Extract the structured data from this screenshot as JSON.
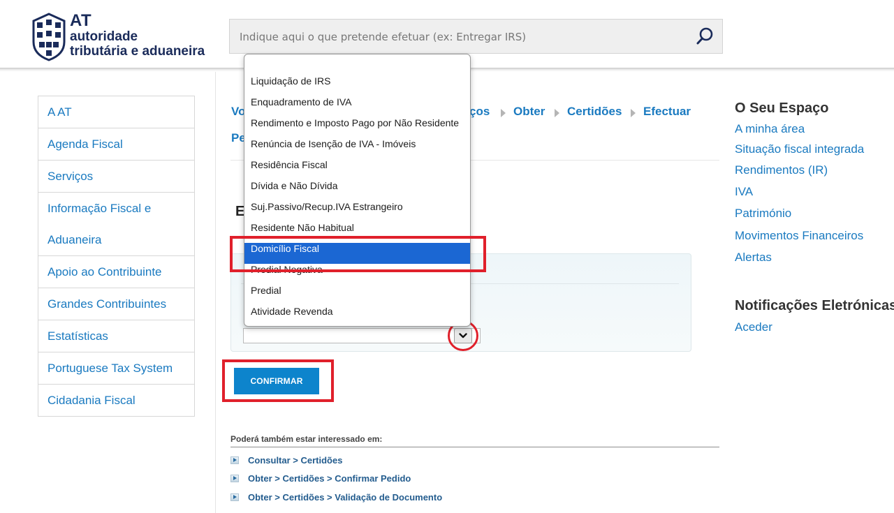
{
  "header": {
    "logo_at": "AT",
    "logo_line1": "autoridade",
    "logo_line2": "tributária e aduaneira",
    "search_placeholder": "Indique aqui o que pretende efetuar (ex: Entregar IRS)"
  },
  "leftnav": {
    "items": [
      {
        "label": "A AT"
      },
      {
        "label": "Agenda Fiscal"
      },
      {
        "label": "Serviços"
      },
      {
        "label_line1": "Informação Fiscal e",
        "label_line2": "Aduaneira"
      },
      {
        "label": "Apoio ao Contribuinte"
      },
      {
        "label": "Grandes Contribuintes"
      },
      {
        "label": "Estatísticas"
      },
      {
        "label": "Portuguese Tax System"
      },
      {
        "label": "Cidadania Fiscal"
      }
    ]
  },
  "breadcrumb": {
    "partial_left_1": "Vo",
    "partial_right": "ços",
    "obter": "Obter",
    "certidoes": "Certidões",
    "efectuar": "Efectuar",
    "partial_left_2": "Pe"
  },
  "section": {
    "title_partial": "E"
  },
  "dropdown": {
    "options": [
      "Liquidação de IRS",
      "Enquadramento de IVA",
      "Rendimento e Imposto Pago por Não Residente",
      "Renúncia de Isenção de IVA - Imóveis",
      "Residência Fiscal",
      "Dívida e Não Dívida",
      "Suj.Passivo/Recup.IVA Estrangeiro",
      "Residente Não Habitual",
      "Domicílio Fiscal",
      "Predial Negativa",
      "Predial",
      "Atividade Revenda"
    ],
    "selected": "Domicílio Fiscal"
  },
  "confirm_label": "CONFIRMAR",
  "related": {
    "title": "Poderá também estar interessado em:",
    "links": [
      "Consultar > Certidões",
      "Obter > Certidões > Confirmar Pedido",
      "Obter > Certidões > Validação de Documento"
    ]
  },
  "right": {
    "heading1": "O Seu Espaço",
    "links1": [
      "A minha área",
      "Situação fiscal integrada",
      "Rendimentos (IR)",
      "IVA",
      "Património",
      "Movimentos Financeiros",
      "Alertas"
    ],
    "heading2": "Notificações Eletrónicas",
    "links2": [
      "Aceder"
    ]
  },
  "colors": {
    "link_blue": "#1a7ac0",
    "selected_blue": "#1b67d3",
    "button_blue": "#0d84cc",
    "annotation_red": "#e0202b",
    "logo_navy": "#1a2b5a"
  },
  "icons": {
    "search": "search-icon",
    "logo": "at-shield-logo-icon",
    "chevron": "chevron-down-icon",
    "bullet": "bullet-arrow-icon"
  }
}
